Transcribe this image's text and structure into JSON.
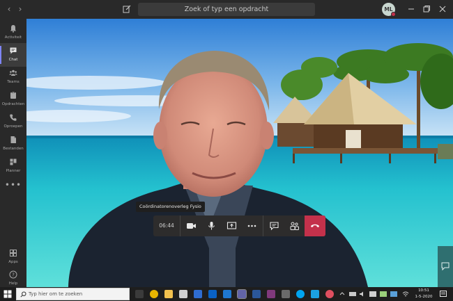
{
  "titlebar": {
    "search_placeholder": "Zoek of typ een opdracht",
    "user_initials": "ML",
    "icons": [
      "back-arrow-icon",
      "forward-arrow-icon",
      "compose-icon",
      "minimize-icon",
      "maximize-icon",
      "close-icon"
    ]
  },
  "rail": {
    "items": [
      {
        "label": "Activiteit",
        "icon": "bell-icon"
      },
      {
        "label": "Chat",
        "icon": "chat-icon",
        "active": true
      },
      {
        "label": "Teams",
        "icon": "teams-icon"
      },
      {
        "label": "Opdrachten",
        "icon": "assignments-icon"
      },
      {
        "label": "Oproepen",
        "icon": "phone-icon"
      },
      {
        "label": "Bestanden",
        "icon": "files-icon"
      },
      {
        "label": "Planner",
        "icon": "planner-icon"
      }
    ],
    "more": "•••",
    "bottom": [
      {
        "label": "Apps",
        "icon": "apps-icon"
      },
      {
        "label": "Help",
        "icon": "help-icon"
      }
    ]
  },
  "call": {
    "tooltip": "Coördinatorenoverleg Fysio",
    "timer": "06:44",
    "accent_hangup": "#c4314b"
  },
  "taskbar": {
    "search_placeholder": "Typ hier om te zoeken",
    "time": "10:51",
    "date": "1-5-2020"
  }
}
